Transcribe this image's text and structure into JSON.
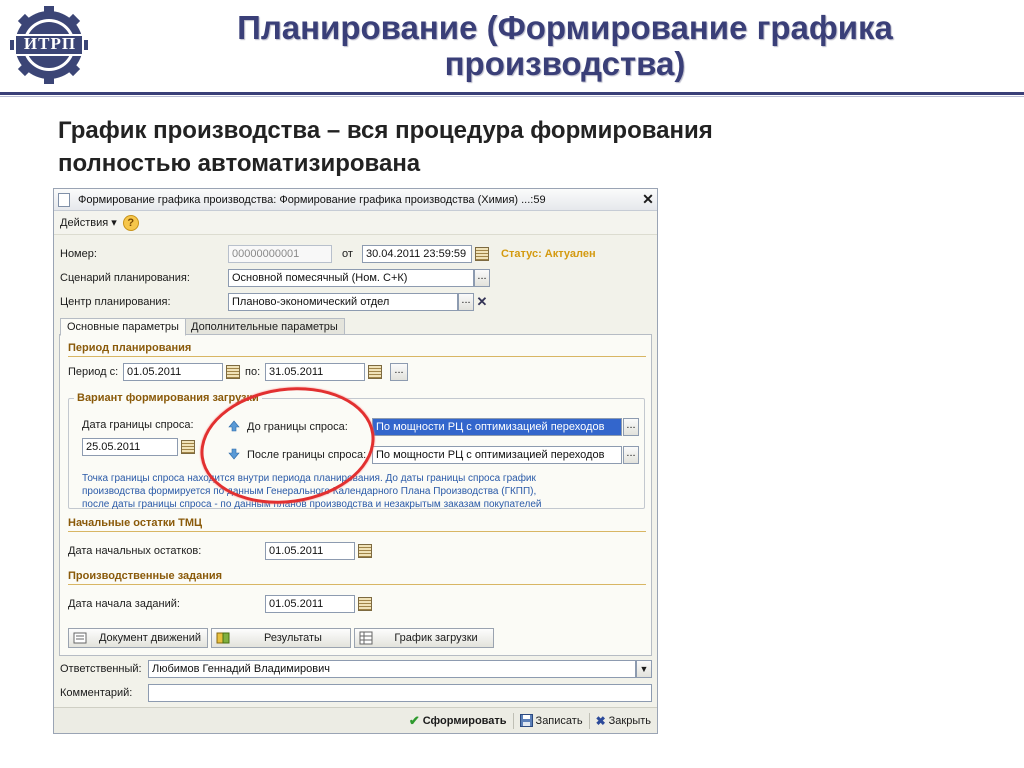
{
  "slide": {
    "logo_text": "ИТРП",
    "title_line1": "Планирование (Формирование графика",
    "title_line2": "производства)",
    "subtitle_line1": "График производства – вся процедура формирования",
    "subtitle_line2": "полностью автоматизирована"
  },
  "window": {
    "title": "Формирование графика производства: Формирование графика производства (Химия) ...:59",
    "close_glyph": "✕",
    "toolbar": {
      "actions_label": "Действия ▾",
      "help_glyph": "?"
    },
    "header_fields": {
      "number_label": "Номер:",
      "number_value": "00000000001",
      "from_label": "от",
      "date_value": "30.04.2011 23:59:59",
      "status_text": "Статус: Актуален",
      "scenario_label": "Сценарий планирования:",
      "scenario_value": "Основной помесячный (Ном. С+К)",
      "center_label": "Центр планирования:",
      "center_value": "Планово-экономический отдел"
    },
    "tabs": [
      {
        "label": "Основные параметры",
        "active": true
      },
      {
        "label": "Дополнительные параметры",
        "active": false
      }
    ],
    "period": {
      "section_title": "Период планирования",
      "from_label": "Период с:",
      "from_value": "01.05.2011",
      "to_label": "по:",
      "to_value": "31.05.2011",
      "dots": "..."
    },
    "variant": {
      "section_title": "Вариант формирования загрузки",
      "demand_date_label": "Дата границы спроса:",
      "demand_date_value": "25.05.2011",
      "before_label": "До границы спроса:",
      "before_value": "По мощности РЦ с оптимизацией переходов",
      "after_label": "После границы спроса:",
      "after_value": "По мощности РЦ с оптимизацией переходов",
      "note_line1": "Точка границы спроса находится внутри периода планирования. До даты границы спроса график",
      "note_line2": "производства формируется по данным Генерального Календарного Плана Производства (ГКПП),",
      "note_line3": "после даты границы спроса - по данным планов производства и незакрытым заказам покупателей"
    },
    "stock": {
      "section_title": "Начальные остатки ТМЦ",
      "date_label": "Дата начальных остатков:",
      "date_value": "01.05.2011"
    },
    "tasks": {
      "section_title": "Производственные задания",
      "date_label": "Дата начала заданий:",
      "date_value": "01.05.2011"
    },
    "buttons": {
      "movements": "Документ движений",
      "results": "Результаты",
      "load_chart": "График загрузки"
    },
    "footer_fields": {
      "responsible_label": "Ответственный:",
      "responsible_value": "Любимов Геннадий Владимирович",
      "comment_label": "Комментарий:",
      "comment_value": ""
    },
    "bottom_bar": {
      "form_label": "Сформировать",
      "save_label": "Записать",
      "close_label": "Закрыть"
    }
  },
  "colors": {
    "title": "#3a3f78",
    "status": "#d49a10",
    "section": "#8a5a0a",
    "note": "#2a5aa8",
    "highlight_ring": "#e23030"
  }
}
